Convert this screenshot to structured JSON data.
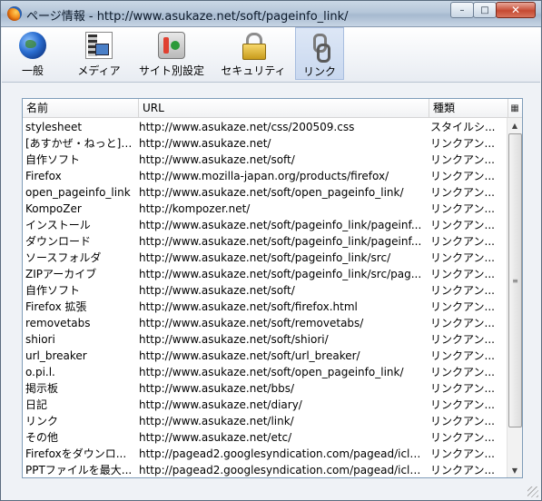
{
  "window": {
    "title": "ページ情報 - http://www.asukaze.net/soft/pageinfo_link/",
    "minimize": "–",
    "maximize": "□",
    "close": "✕"
  },
  "toolbar": {
    "general": "一般",
    "media": "メディア",
    "site_settings": "サイト別設定",
    "security": "セキュリティ",
    "links": "リンク"
  },
  "table": {
    "headers": {
      "name": "名前",
      "url": "URL",
      "type": "種類"
    },
    "rows": [
      {
        "name": "stylesheet",
        "url": "http://www.asukaze.net/css/200509.css",
        "type": "スタイルシ..."
      },
      {
        "name": "[あすかぜ・ねっと] ...",
        "url": "http://www.asukaze.net/",
        "type": "リンクアン..."
      },
      {
        "name": "自作ソフト",
        "url": "http://www.asukaze.net/soft/",
        "type": "リンクアン..."
      },
      {
        "name": "Firefox",
        "url": "http://www.mozilla-japan.org/products/firefox/",
        "type": "リンクアン..."
      },
      {
        "name": "open_pageinfo_link",
        "url": "http://www.asukaze.net/soft/open_pageinfo_link/",
        "type": "リンクアン..."
      },
      {
        "name": "KompoZer",
        "url": "http://kompozer.net/",
        "type": "リンクアン..."
      },
      {
        "name": "インストール",
        "url": "http://www.asukaze.net/soft/pageinfo_link/pageinf...",
        "type": "リンクアン..."
      },
      {
        "name": "ダウンロード",
        "url": "http://www.asukaze.net/soft/pageinfo_link/pageinf...",
        "type": "リンクアン..."
      },
      {
        "name": "ソースフォルダ",
        "url": "http://www.asukaze.net/soft/pageinfo_link/src/",
        "type": "リンクアン..."
      },
      {
        "name": "ZIPアーカイブ",
        "url": "http://www.asukaze.net/soft/pageinfo_link/src/pag...",
        "type": "リンクアン..."
      },
      {
        "name": "自作ソフト",
        "url": "http://www.asukaze.net/soft/",
        "type": "リンクアン..."
      },
      {
        "name": "Firefox 拡張",
        "url": "http://www.asukaze.net/soft/firefox.html",
        "type": "リンクアン..."
      },
      {
        "name": "removetabs",
        "url": "http://www.asukaze.net/soft/removetabs/",
        "type": "リンクアン..."
      },
      {
        "name": "shiori",
        "url": "http://www.asukaze.net/soft/shiori/",
        "type": "リンクアン..."
      },
      {
        "name": "url_breaker",
        "url": "http://www.asukaze.net/soft/url_breaker/",
        "type": "リンクアン..."
      },
      {
        "name": "o.pi.l.",
        "url": "http://www.asukaze.net/soft/open_pageinfo_link/",
        "type": "リンクアン..."
      },
      {
        "name": "掲示板",
        "url": "http://www.asukaze.net/bbs/",
        "type": "リンクアン..."
      },
      {
        "name": "日記",
        "url": "http://www.asukaze.net/diary/",
        "type": "リンクアン..."
      },
      {
        "name": "リンク",
        "url": "http://www.asukaze.net/link/",
        "type": "リンクアン..."
      },
      {
        "name": "その他",
        "url": "http://www.asukaze.net/etc/",
        "type": "リンクアン..."
      },
      {
        "name": "Firefoxをダウンロ...",
        "url": "http://pagead2.googlesyndication.com/pagead/iclk?...",
        "type": "リンクアン..."
      },
      {
        "name": "PPTファイルを最大...",
        "url": "http://pagead2.googlesyndication.com/pagead/iclk?...",
        "type": "リンクアン..."
      }
    ]
  }
}
